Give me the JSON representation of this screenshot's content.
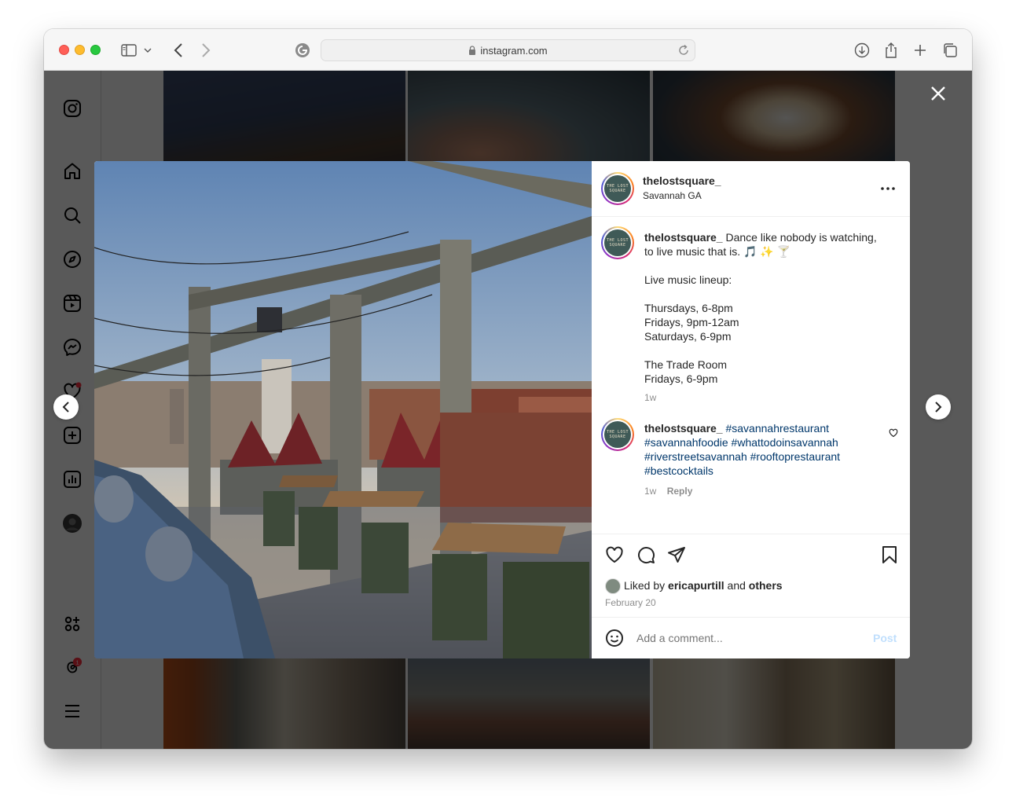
{
  "browser": {
    "url": "instagram.com"
  },
  "sidebar": {
    "items": [
      {
        "icon": "instagram-logo-icon"
      },
      {
        "icon": "home-icon"
      },
      {
        "icon": "search-icon"
      },
      {
        "icon": "explore-icon"
      },
      {
        "icon": "reels-icon"
      },
      {
        "icon": "messenger-icon"
      },
      {
        "icon": "heart-notifications-icon"
      },
      {
        "icon": "create-icon"
      },
      {
        "icon": "dashboard-icon"
      },
      {
        "icon": "profile-avatar"
      },
      {
        "icon": "also-from-meta-icon"
      },
      {
        "icon": "threads-icon",
        "badge": "1"
      },
      {
        "icon": "menu-icon"
      }
    ]
  },
  "post": {
    "username": "thelostsquare_",
    "location": "Savannah GA",
    "avatar_text": "THE LOST SQUARE",
    "caption_lines": [
      "Dance like nobody is watching,",
      "to live music that is. 🎵 ✨ 🍸",
      "",
      "Live music lineup:",
      "",
      "Thursdays, 6-8pm",
      "Fridays, 9pm-12am",
      "Saturdays, 6-9pm",
      "",
      "The Trade Room",
      "Fridays, 6-9pm"
    ],
    "caption_time": "1w",
    "comment": {
      "username": "thelostsquare_",
      "hashtags": [
        "#savannahrestaurant",
        "#savannahfoodie",
        "#whattodoinsavannah",
        "#riverstreetsavannah",
        "#rooftoprestaurant",
        "#bestcocktails"
      ],
      "time": "1w",
      "reply_label": "Reply"
    },
    "likes": {
      "prefix": "Liked by",
      "user": "ericapurtill",
      "joiner": "and",
      "others": "others"
    },
    "date": "February 20",
    "comment_placeholder": "Add a comment...",
    "post_label": "Post"
  },
  "colors": {
    "accent_link": "#00376b",
    "post_button_disabled": "#c0dffd",
    "notification_red": "#ff3040"
  }
}
